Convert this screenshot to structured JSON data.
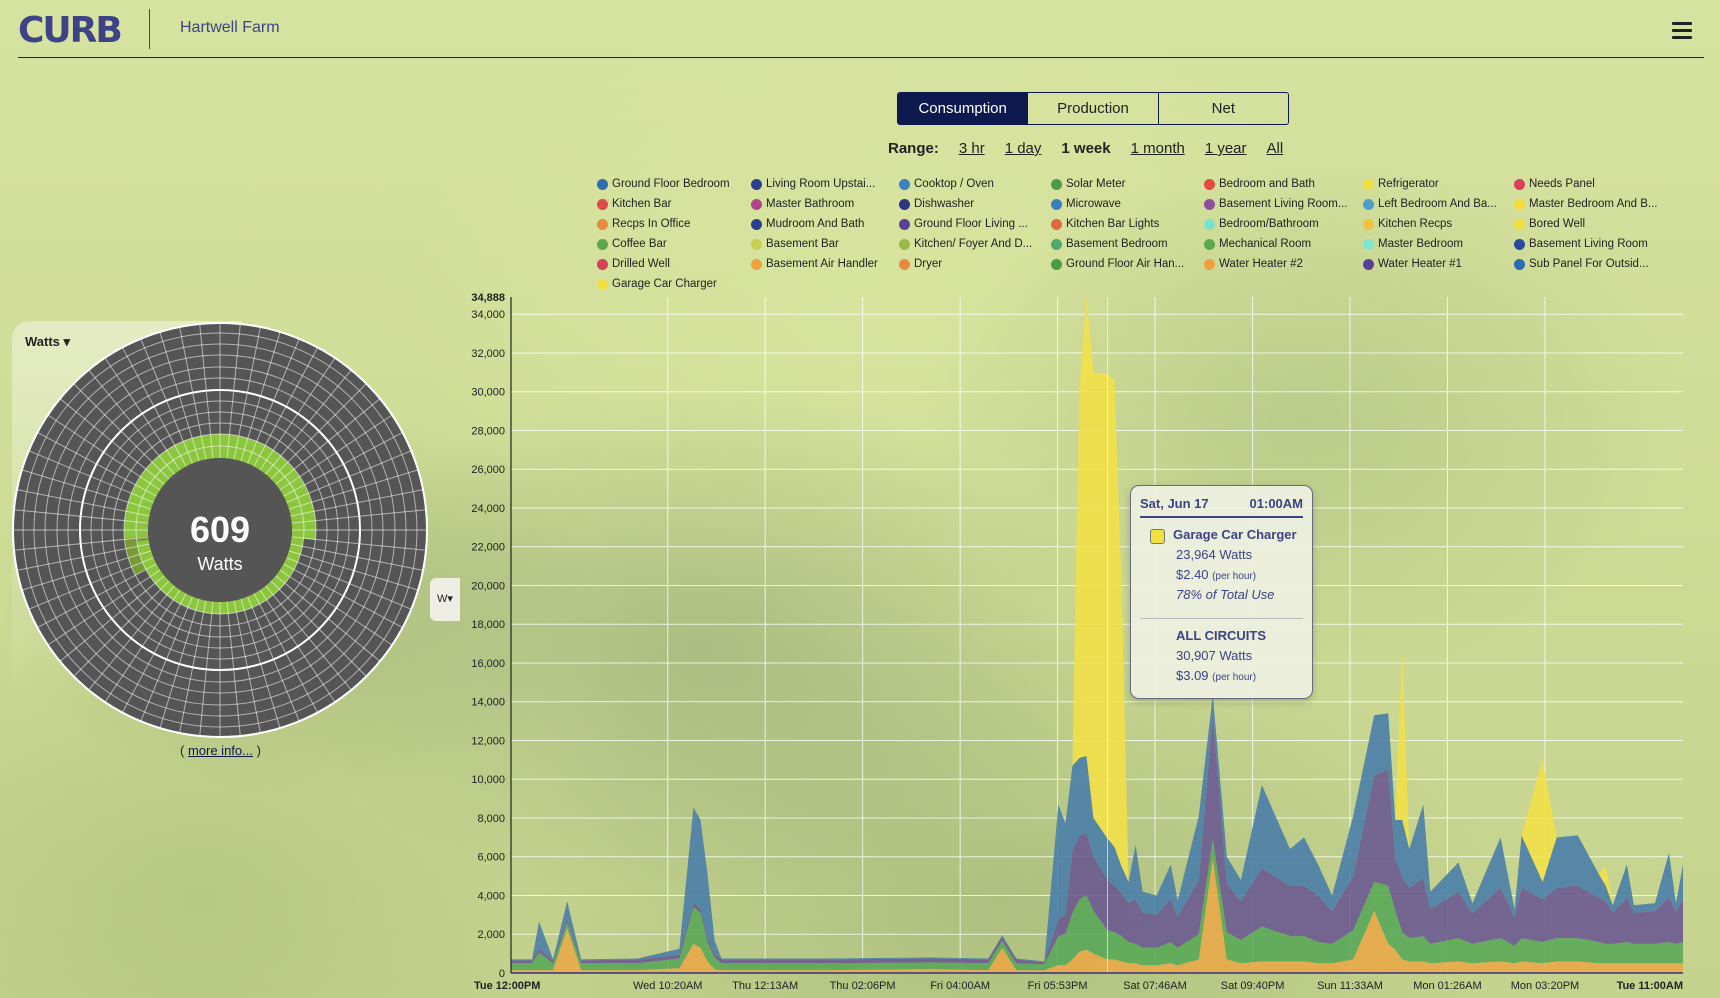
{
  "header": {
    "logo": "CURB",
    "site_name": "Hartwell Farm",
    "menu_icon": "hamburger-icon"
  },
  "tabs": [
    {
      "label": "Consumption",
      "active": true
    },
    {
      "label": "Production",
      "active": false
    },
    {
      "label": "Net",
      "active": false
    }
  ],
  "range": {
    "label": "Range:",
    "options": [
      {
        "label": "3 hr"
      },
      {
        "label": "1 day"
      },
      {
        "label": "1 week",
        "selected": true
      },
      {
        "label": "1 month"
      },
      {
        "label": "1 year"
      },
      {
        "label": "All"
      }
    ]
  },
  "legend": [
    {
      "label": "Ground Floor Bedroom",
      "color": "#2f6db5"
    },
    {
      "label": "Living Room Upstai...",
      "color": "#2d3f8f"
    },
    {
      "label": "Cooktop / Oven",
      "color": "#3a82c4"
    },
    {
      "label": "Solar Meter",
      "color": "#4e9a48"
    },
    {
      "label": "Bedroom and Bath",
      "color": "#e04a3f"
    },
    {
      "label": "Refrigerator",
      "color": "#f2e040"
    },
    {
      "label": "Needs Panel",
      "color": "#d9405a"
    },
    {
      "label": "Kitchen Bar",
      "color": "#e04a4a"
    },
    {
      "label": "Master Bathroom",
      "color": "#b0468a"
    },
    {
      "label": "Dishwasher",
      "color": "#2d3585"
    },
    {
      "label": "Microwave",
      "color": "#3a80c0"
    },
    {
      "label": "Basement Living Room...",
      "color": "#8e4e9e"
    },
    {
      "label": "Left Bedroom And Ba...",
      "color": "#4aa0c8"
    },
    {
      "label": "Master Bedroom And B...",
      "color": "#f2dc40"
    },
    {
      "label": "Recps In Office",
      "color": "#e88a40"
    },
    {
      "label": "Mudroom And Bath",
      "color": "#2d3f8f"
    },
    {
      "label": "Ground Floor Living ...",
      "color": "#5a3f9a"
    },
    {
      "label": "Kitchen Bar Lights",
      "color": "#e06a40"
    },
    {
      "label": "Bedroom/Bathroom",
      "color": "#7de0c8"
    },
    {
      "label": "Kitchen Recps",
      "color": "#f5c040"
    },
    {
      "label": "Bored Well",
      "color": "#f2dc40"
    },
    {
      "label": "Coffee Bar",
      "color": "#5aa850"
    },
    {
      "label": "Basement Bar",
      "color": "#c8d050"
    },
    {
      "label": "Kitchen/ Foyer And D...",
      "color": "#98b848"
    },
    {
      "label": "Basement Bedroom",
      "color": "#50a870"
    },
    {
      "label": "Mechanical Room",
      "color": "#5aa850"
    },
    {
      "label": "Master Bedroom",
      "color": "#7de8d0"
    },
    {
      "label": "Basement Living Room",
      "color": "#2d4a9a"
    },
    {
      "label": "Drilled Well",
      "color": "#d9405a"
    },
    {
      "label": "Basement Air Handler",
      "color": "#f0a040"
    },
    {
      "label": "Dryer",
      "color": "#e88a40"
    },
    {
      "label": "Ground Floor Air Han...",
      "color": "#4a9a48"
    },
    {
      "label": "Water Heater #2",
      "color": "#f0a040"
    },
    {
      "label": "Water Heater #1",
      "color": "#5a3f9a"
    },
    {
      "label": "Sub Panel For Outsid...",
      "color": "#2d6ab0"
    },
    {
      "label": "Garage Car Charger",
      "color": "#f2e040"
    }
  ],
  "gauge": {
    "selector_label": "Watts",
    "value": "609",
    "unit": "Watts",
    "unit_button": "W",
    "more_info_prefix": "( ",
    "more_info_link": "more info...",
    "more_info_suffix": " )",
    "ring_color": "#8cc63f",
    "dial_color": "#555555"
  },
  "tooltip": {
    "date": "Sat, Jun 17",
    "time": "01:00AM",
    "circuit": "Garage Car Charger",
    "circuit_color": "#f2e040",
    "circuit_watts": "23,964 Watts",
    "circuit_cost": "$2.40",
    "per_hour": "(per hour)",
    "share": "78% of Total Use",
    "all_label": "ALL CIRCUITS",
    "all_watts": "30,907 Watts",
    "all_cost": "$3.09"
  },
  "chart_data": {
    "type": "area",
    "stacked": true,
    "ylim": [
      0,
      34888
    ],
    "ymax_label": "34,888",
    "yticks": [
      "0",
      "2,000",
      "4,000",
      "6,000",
      "8,000",
      "10,000",
      "12,000",
      "14,000",
      "16,000",
      "18,000",
      "20,000",
      "22,000",
      "24,000",
      "26,000",
      "28,000",
      "30,000",
      "32,000",
      "34,000"
    ],
    "xticks": [
      {
        "label": "Tue 12:00PM",
        "t": "Jun 13 12:00",
        "bold": true
      },
      {
        "label": "Wed 10:20AM",
        "t": "Jun 14 10:20"
      },
      {
        "label": "Thu 12:13AM",
        "t": "Jun 15 00:13"
      },
      {
        "label": "Thu 02:06PM",
        "t": "Jun 15 14:06"
      },
      {
        "label": "Fri 04:00AM",
        "t": "Jun 16 04:00"
      },
      {
        "label": "Fri 05:53PM",
        "t": "Jun 16 17:53"
      },
      {
        "label": "Sat 07:46AM",
        "t": "Jun 17 07:46"
      },
      {
        "label": "Sat 09:40PM",
        "t": "Jun 17 21:40"
      },
      {
        "label": "Sun 11:33AM",
        "t": "Jun 18 11:33"
      },
      {
        "label": "Mon 01:26AM",
        "t": "Jun 19 01:26"
      },
      {
        "label": "Mon 03:20PM",
        "t": "Jun 19 15:20"
      },
      {
        "label": "Tue 11:00AM",
        "t": "Jun 20 11:00",
        "bold": true
      }
    ],
    "grid": true,
    "hover_time": "Jun 17 01:00",
    "x": [
      "Jun 13 12:00",
      "Jun 13 15:00",
      "Jun 13 16:00",
      "Jun 13 18:00",
      "Jun 13 20:00",
      "Jun 13 22:00",
      "Jun 14 06:00",
      "Jun 14 12:00",
      "Jun 14 14:00",
      "Jun 14 15:00",
      "Jun 14 16:00",
      "Jun 14 17:00",
      "Jun 14 18:00",
      "Jun 15 09:00",
      "Jun 16 00:00",
      "Jun 16 08:00",
      "Jun 16 10:00",
      "Jun 16 12:00",
      "Jun 16 16:00",
      "Jun 16 18:00",
      "Jun 16 19:00",
      "Jun 16 20:00",
      "Jun 16 21:00",
      "Jun 16 22:00",
      "Jun 16 23:00",
      "Jun 17 01:00",
      "Jun 17 02:00",
      "Jun 17 03:00",
      "Jun 17 04:00",
      "Jun 17 05:00",
      "Jun 17 06:00",
      "Jun 17 08:00",
      "Jun 17 10:00",
      "Jun 17 11:00",
      "Jun 17 14:00",
      "Jun 17 16:00",
      "Jun 17 18:00",
      "Jun 17 20:00",
      "Jun 17 23:00",
      "Jun 18 03:00",
      "Jun 18 05:00",
      "Jun 18 07:00",
      "Jun 18 09:00",
      "Jun 18 12:00",
      "Jun 18 15:00",
      "Jun 18 17:00",
      "Jun 18 18:00",
      "Jun 18 19:00",
      "Jun 18 20:00",
      "Jun 18 22:00",
      "Jun 18 23:00",
      "Jun 19 03:00",
      "Jun 19 05:00",
      "Jun 19 09:00",
      "Jun 19 11:00",
      "Jun 19 12:00",
      "Jun 19 15:00",
      "Jun 19 17:00",
      "Jun 19 20:00",
      "Jun 19 23:00",
      "Jun 20 00:00",
      "Jun 20 01:00",
      "Jun 20 03:00",
      "Jun 20 04:00",
      "Jun 20 07:00",
      "Jun 20 09:00",
      "Jun 20 10:00",
      "Jun 20 11:00"
    ],
    "series": [
      {
        "name": "Water Heater #2",
        "color": "#e8a848",
        "values": [
          150,
          150,
          150,
          150,
          2300,
          150,
          150,
          250,
          1500,
          1300,
          600,
          200,
          150,
          150,
          200,
          150,
          1300,
          150,
          150,
          400,
          400,
          700,
          1100,
          1200,
          1000,
          700,
          700,
          600,
          500,
          500,
          400,
          400,
          500,
          400,
          700,
          5900,
          700,
          500,
          600,
          600,
          600,
          500,
          500,
          700,
          3200,
          1500,
          1200,
          700,
          600,
          600,
          500,
          600,
          500,
          600,
          500,
          600,
          500,
          600,
          600,
          500,
          500,
          500,
          500,
          500,
          500,
          500,
          500,
          500
        ]
      },
      {
        "name": "Ground Floor Air Han...",
        "color": "#5aa858",
        "values": [
          350,
          350,
          900,
          350,
          300,
          350,
          350,
          500,
          1900,
          1800,
          1000,
          600,
          350,
          350,
          350,
          350,
          350,
          350,
          300,
          1500,
          1600,
          2400,
          2700,
          2800,
          2200,
          1500,
          1400,
          1300,
          1100,
          1000,
          900,
          900,
          1100,
          900,
          1300,
          1000,
          1400,
          1200,
          1800,
          1300,
          1300,
          1100,
          1000,
          1500,
          1500,
          3000,
          2000,
          1400,
          1200,
          1300,
          1000,
          1200,
          1000,
          1200,
          900,
          1200,
          1100,
          1200,
          1200,
          1100,
          1000,
          1000,
          1100,
          1000,
          1000,
          1100,
          1000,
          1100
        ]
      },
      {
        "name": "Water Heater #1",
        "color": "#6a5a90",
        "values": [
          150,
          150,
          200,
          150,
          200,
          150,
          200,
          200,
          250,
          200,
          200,
          200,
          200,
          200,
          200,
          200,
          200,
          200,
          100,
          900,
          1000,
          3200,
          3300,
          3200,
          2800,
          2600,
          2400,
          2200,
          2000,
          2300,
          1800,
          1700,
          2200,
          1600,
          2800,
          6400,
          2500,
          2000,
          3000,
          2600,
          2600,
          2400,
          1700,
          2800,
          5500,
          6000,
          2800,
          2800,
          2600,
          3000,
          1800,
          2400,
          1600,
          2600,
          1500,
          2600,
          2200,
          2600,
          2700,
          2300,
          2200,
          1600,
          2300,
          1600,
          1700,
          2300,
          1700,
          2200
        ]
      },
      {
        "name": "Sub Panel For Outsid...",
        "color": "#4a7ea8",
        "values": [
          50,
          50,
          1400,
          50,
          900,
          50,
          50,
          300,
          4900,
          4600,
          3300,
          700,
          50,
          50,
          50,
          50,
          100,
          50,
          50,
          5900,
          4700,
          4400,
          4000,
          4000,
          2000,
          2143,
          2000,
          1400,
          1100,
          2800,
          1100,
          1000,
          1800,
          850,
          3300,
          1050,
          1400,
          1100,
          4300,
          1900,
          2500,
          1600,
          800,
          3100,
          3100,
          2900,
          1900,
          3000,
          2000,
          3800,
          900,
          1500,
          500,
          2600,
          400,
          2700,
          900,
          2600,
          2600,
          1200,
          800,
          400,
          1700,
          400,
          400,
          2300,
          400,
          1800
        ]
      },
      {
        "name": "Garage Car Charger",
        "color": "#f2e048",
        "values": [
          0,
          0,
          0,
          0,
          0,
          0,
          0,
          0,
          0,
          0,
          0,
          0,
          0,
          0,
          0,
          0,
          0,
          0,
          0,
          0,
          0,
          0,
          19000,
          23700,
          23000,
          23964,
          24100,
          14500,
          0,
          0,
          0,
          0,
          0,
          0,
          0,
          0,
          0,
          0,
          0,
          0,
          0,
          0,
          0,
          0,
          0,
          0,
          0,
          8600,
          0,
          0,
          0,
          0,
          0,
          0,
          0,
          0,
          6300,
          0,
          0,
          0,
          1000,
          0,
          0,
          0,
          0,
          0,
          0,
          0
        ]
      }
    ]
  }
}
